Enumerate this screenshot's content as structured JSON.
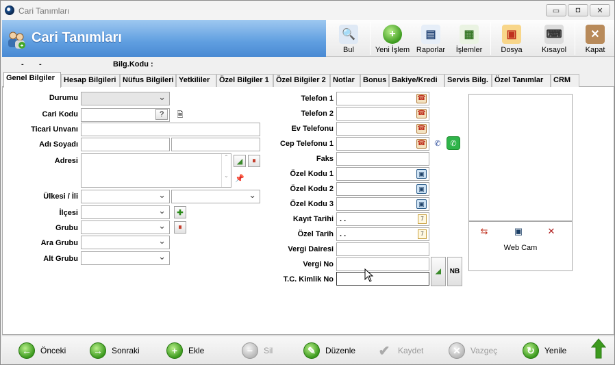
{
  "window": {
    "title": "Cari Tanımları"
  },
  "banner": {
    "title": "Cari Tanımları"
  },
  "toolbar": {
    "bul": "Bul",
    "yeni_islem": "Yeni İşlem",
    "raporlar": "Raporlar",
    "islemler": "İşlemler",
    "dosya": "Dosya",
    "kisayol": "Kısayol",
    "kapat": "Kapat"
  },
  "info": {
    "dash1": "-",
    "dash2": "-",
    "bilg_kodu_label": "Bilg.Kodu :"
  },
  "tabs": [
    "Genel Bilgiler",
    "Hesap Bilgileri",
    "Nüfus Bilgileri",
    "Yetkililer",
    "Özel Bilgiler 1",
    "Özel Bilgiler 2",
    "Notlar",
    "Bonus",
    "Bakiye/Kredi",
    "Servis Bilg.",
    "Özel Tanımlar",
    "CRM"
  ],
  "left_form": {
    "durumu": "Durumu",
    "cari_kodu": "Cari Kodu",
    "ticari_unvani": "Ticari Unvanı",
    "adi_soyadi": "Adı Soyadı",
    "adresi": "Adresi",
    "ulkesi_ili": "Ülkesi / İli",
    "ilcesi": "İlçesi",
    "grubu": "Grubu",
    "ara_grubu": "Ara Grubu",
    "alt_grubu": "Alt Grubu",
    "help_btn": "?"
  },
  "right_form": {
    "telefon1": "Telefon 1",
    "telefon2": "Telefon 2",
    "ev_telefonu": "Ev Telefonu",
    "cep_telefonu1": "Cep Telefonu 1",
    "faks": "Faks",
    "ozel_kodu1": "Özel Kodu 1",
    "ozel_kodu2": "Özel Kodu 2",
    "ozel_kodu3": "Özel Kodu 3",
    "kayit_tarihi": "Kayıt Tarihi",
    "ozel_tarih": "Özel Tarih",
    "vergi_dairesi": "Vergi Dairesi",
    "vergi_no": "Vergi No",
    "tc_kimlik_no": "T.C. Kimlik No",
    "kayit_tarihi_value": ". .",
    "ozel_tarih_value": ". .",
    "nb_btn": "NB"
  },
  "webcam": {
    "label": "Web Cam"
  },
  "bottom": {
    "onceki": "Önceki",
    "sonraki": "Sonraki",
    "ekle": "Ekle",
    "sil": "Sil",
    "duzenle": "Düzenle",
    "kaydet": "Kaydet",
    "vazgec": "Vazgeç",
    "yenile": "Yenile"
  }
}
